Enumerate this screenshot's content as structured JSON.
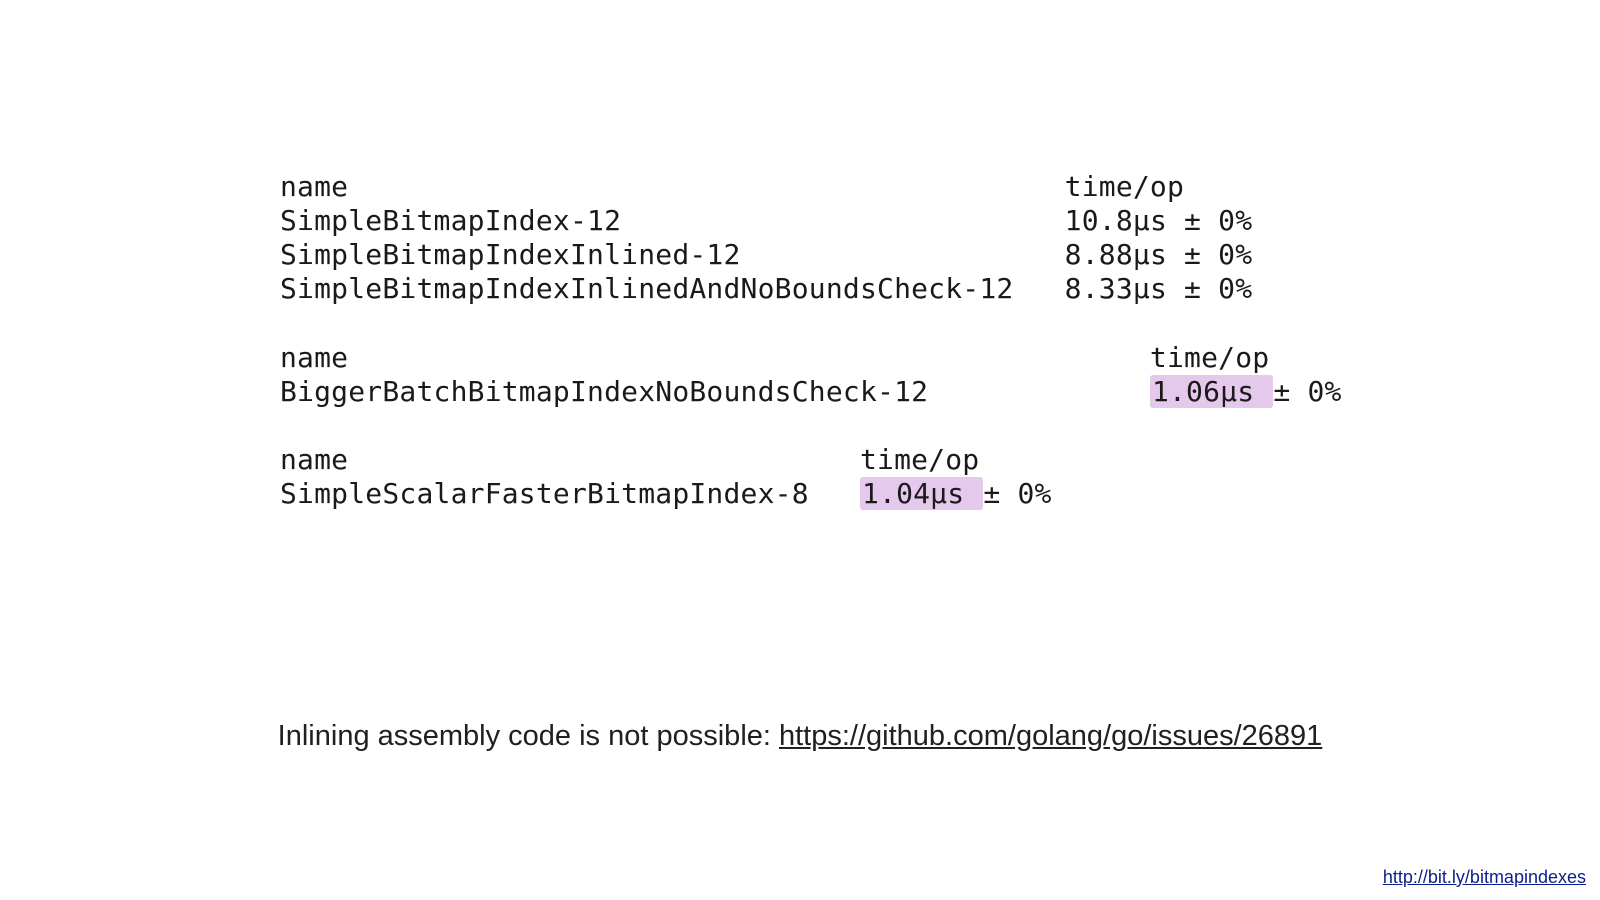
{
  "benchGroups": [
    {
      "header": {
        "name": "name",
        "time": "time/op"
      },
      "nameColWidth": 46,
      "rows": [
        {
          "name": "SimpleBitmapIndex-12",
          "time": "10.8µs ± 0%",
          "highlight": false
        },
        {
          "name": "SimpleBitmapIndexInlined-12",
          "time": "8.88µs ± 0%",
          "highlight": false
        },
        {
          "name": "SimpleBitmapIndexInlinedAndNoBoundsCheck-12",
          "time": "8.33µs ± 0%",
          "highlight": false
        }
      ]
    },
    {
      "header": {
        "name": "name",
        "time": "time/op"
      },
      "nameColWidth": 51,
      "rows": [
        {
          "name": "BiggerBatchBitmapIndexNoBoundsCheck-12",
          "time": "1.06µs ± 0%",
          "highlight": true,
          "hlLen": 7
        }
      ]
    },
    {
      "header": {
        "name": "name",
        "time": "time/op"
      },
      "nameColWidth": 34,
      "rows": [
        {
          "name": "SimpleScalarFasterBitmapIndex-8",
          "time": "1.04µs ± 0%",
          "highlight": true,
          "hlLen": 7
        }
      ]
    }
  ],
  "note": {
    "text": "Inlining assembly code is not possible: ",
    "linkText": "https://github.com/golang/go/issues/26891",
    "linkHref": "https://github.com/golang/go/issues/26891"
  },
  "footerLink": {
    "text": "http://bit.ly/bitmapindexes",
    "href": "http://bit.ly/bitmapindexes"
  }
}
